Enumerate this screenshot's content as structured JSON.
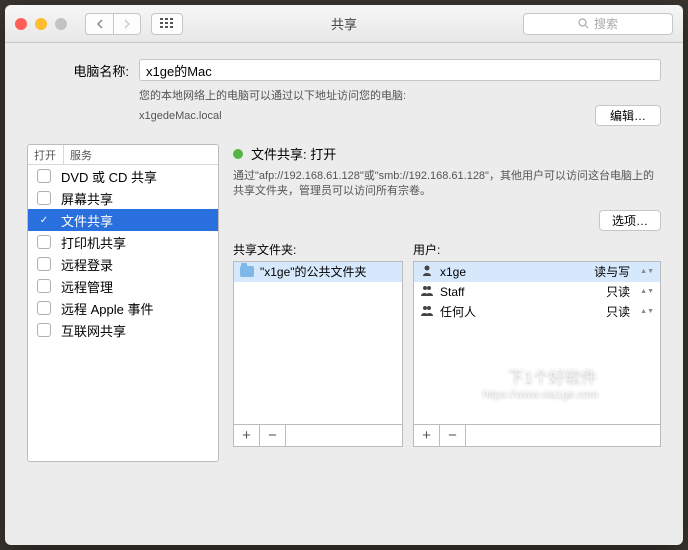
{
  "window": {
    "title": "共享",
    "search_placeholder": "搜索"
  },
  "computer": {
    "name_label": "电脑名称:",
    "name_value": "x1ge的Mac",
    "desc": "您的本地网络上的电脑可以通过以下地址访问您的电脑:",
    "hostname": "x1gedeMac.local",
    "edit_label": "编辑…"
  },
  "services": {
    "col_on": "打开",
    "col_service": "服务",
    "items": [
      {
        "on": false,
        "label": "DVD 或 CD 共享"
      },
      {
        "on": false,
        "label": "屏幕共享"
      },
      {
        "on": true,
        "label": "文件共享"
      },
      {
        "on": false,
        "label": "打印机共享"
      },
      {
        "on": false,
        "label": "远程登录"
      },
      {
        "on": false,
        "label": "远程管理"
      },
      {
        "on": false,
        "label": "远程 Apple 事件"
      },
      {
        "on": false,
        "label": "互联网共享"
      }
    ]
  },
  "detail": {
    "status_title": "文件共享: 打开",
    "status_desc": "通过\"afp://192.168.61.128\"或\"smb://192.168.61.128\"，其他用户可以访问这台电脑上的共享文件夹，管理员可以访问所有宗卷。",
    "options_label": "选项…",
    "folders_label": "共享文件夹:",
    "users_label": "用户:",
    "folders": [
      {
        "label": "\"x1ge\"的公共文件夹"
      }
    ],
    "users": [
      {
        "name": "x1ge",
        "perm": "读与写",
        "icon": "single"
      },
      {
        "name": "Staff",
        "perm": "只读",
        "icon": "group"
      },
      {
        "name": "任何人",
        "perm": "只读",
        "icon": "everyone"
      }
    ]
  },
  "watermark": {
    "main": "下1个好软件",
    "sub": "https://www.xia1ge.com"
  }
}
